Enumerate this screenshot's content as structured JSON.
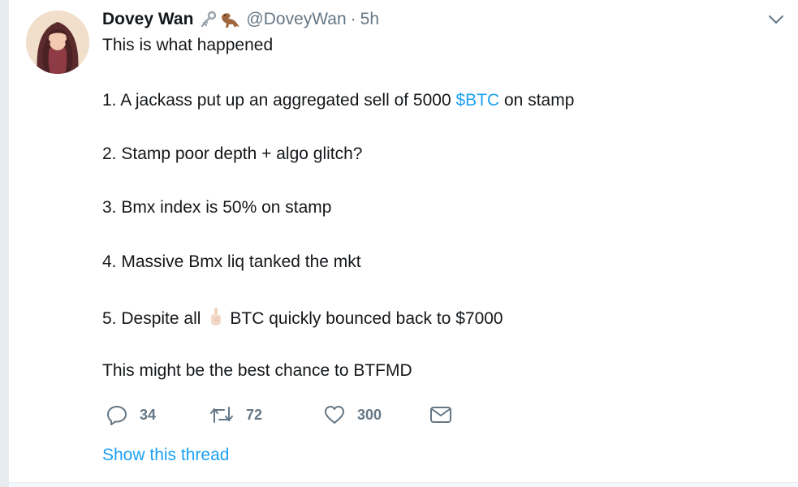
{
  "tweet": {
    "author": {
      "display_name": "Dovey Wan",
      "name_emoji": [
        "key-icon",
        "dinosaur-icon"
      ],
      "handle": "@DoveyWan",
      "separator": "·",
      "time": "5h"
    },
    "lines": [
      {
        "text": "This is what happened"
      },
      {
        "before": "1. A jackass put up an aggregated sell of 5000 ",
        "cashtag": "$BTC",
        "after": " on stamp"
      },
      {
        "text": "2. Stamp poor depth + algo glitch?"
      },
      {
        "text": "3. Bmx index is 50% on stamp"
      },
      {
        "text": "4. Massive Bmx liq tanked the mkt"
      },
      {
        "before": "5. Despite all",
        "emoji": "pointing-finger-icon",
        "after": "BTC quickly bounced back to $7000"
      },
      {
        "text": "This might be the best chance to BTFMD"
      }
    ],
    "actions": {
      "reply_count": "34",
      "retweet_count": "72",
      "like_count": "300"
    },
    "show_thread_label": "Show this thread"
  },
  "colors": {
    "text": "#14171a",
    "secondary": "#657786",
    "link": "#1da1f2",
    "rail": "#e6ecf0"
  }
}
